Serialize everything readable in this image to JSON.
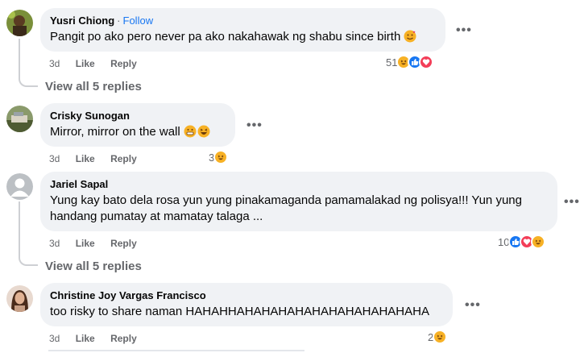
{
  "comments": [
    {
      "author": "Yusri Chiong",
      "follow_label": "Follow",
      "follow_sep": "·",
      "text": "Pangit po ako pero never pa ako nakahawak ng shabu since birth",
      "time": "3d",
      "like_label": "Like",
      "reply_label": "Reply",
      "reaction_count": "51",
      "reactions": [
        "haha-icon",
        "like-icon",
        "love-icon"
      ]
    },
    {
      "author": "Crisky Sunogan",
      "text": "Mirror, mirror on the wall",
      "time": "3d",
      "like_label": "Like",
      "reply_label": "Reply",
      "reaction_count": "3",
      "reactions": [
        "haha-icon"
      ]
    },
    {
      "author": "Jariel Sapal",
      "text_line1": "Yung kay bato dela rosa yun yung pinakamaganda pamamalakad ng polisya!!! Yun yung",
      "text_line2": "handang pumatay at mamatay talaga ...",
      "time": "3d",
      "like_label": "Like",
      "reply_label": "Reply",
      "reaction_count": "10",
      "reactions": [
        "like-icon",
        "love-icon",
        "haha-icon"
      ]
    },
    {
      "author": "Christine Joy Vargas Francisco",
      "text": "too risky to share naman HAHAHHAHAHAHAHAHAHAHAHAHAHAHA",
      "time": "3d",
      "like_label": "Like",
      "reply_label": "Reply",
      "reaction_count": "2",
      "reactions": [
        "haha-icon"
      ]
    }
  ],
  "view_replies_1": "View all 5 replies",
  "view_replies_2": "View all 5 replies",
  "more_glyph": "•••",
  "colors": {
    "bubble": "#f0f2f5",
    "meta": "#65676b",
    "link": "#1877f2",
    "like": "#1877f2",
    "love": "#f33e58",
    "haha": "#f7b125"
  }
}
